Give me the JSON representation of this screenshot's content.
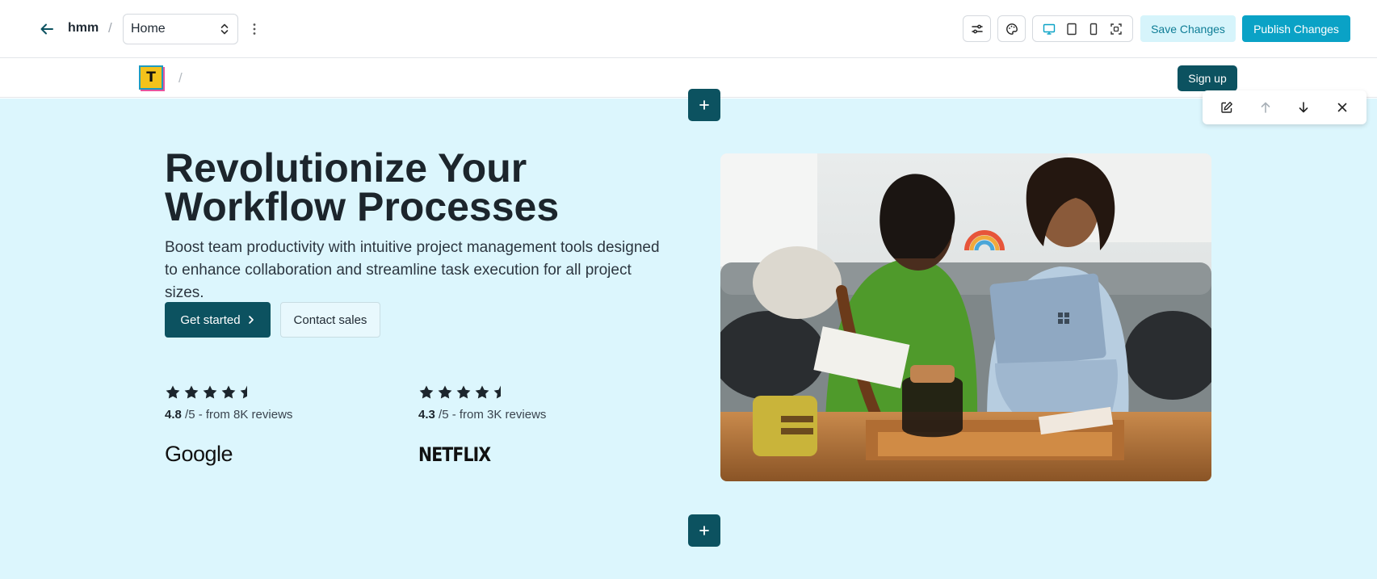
{
  "editor": {
    "site_name": "hmm",
    "breadcrumb_separator": "/",
    "page_select": {
      "selected": "Home"
    },
    "save_label": "Save Changes",
    "publish_label": "Publish Changes"
  },
  "site_nav": {
    "logo_letter": "T",
    "separator": "/",
    "signup_label": "Sign up"
  },
  "hero": {
    "headline": "Revolutionize Your Workflow Processes",
    "subheadline": "Boost team productivity with intuitive project management tools designed to enhance collaboration and streamline task execution for all project sizes.",
    "primary_cta": "Get started",
    "secondary_cta": "Contact sales",
    "ratings": [
      {
        "score": "4.8",
        "suffix": "/5 - from 8K reviews",
        "stars": 4.5,
        "brand": "Google"
      },
      {
        "score": "4.3",
        "suffix": "/5 - from 3K reviews",
        "stars": 4.5,
        "brand": "NETFLIX"
      }
    ]
  },
  "colors": {
    "accent": "#0c5260",
    "publish": "#0aa2c6",
    "save_bg": "#d6f4fb",
    "hero_bg": "#dcf6fd"
  },
  "icons": {
    "back": "arrow-left-icon",
    "page_select": "chevron-up-down-icon",
    "more": "more-vertical-icon",
    "settings": "sliders-icon",
    "theme": "palette-icon",
    "devices": [
      "desktop-icon",
      "tablet-icon",
      "mobile-icon",
      "fit-screen-icon"
    ],
    "section_tools": [
      "edit-icon",
      "arrow-up-icon",
      "arrow-down-icon",
      "close-icon"
    ],
    "add": "plus-icon",
    "star": "star-icon"
  }
}
